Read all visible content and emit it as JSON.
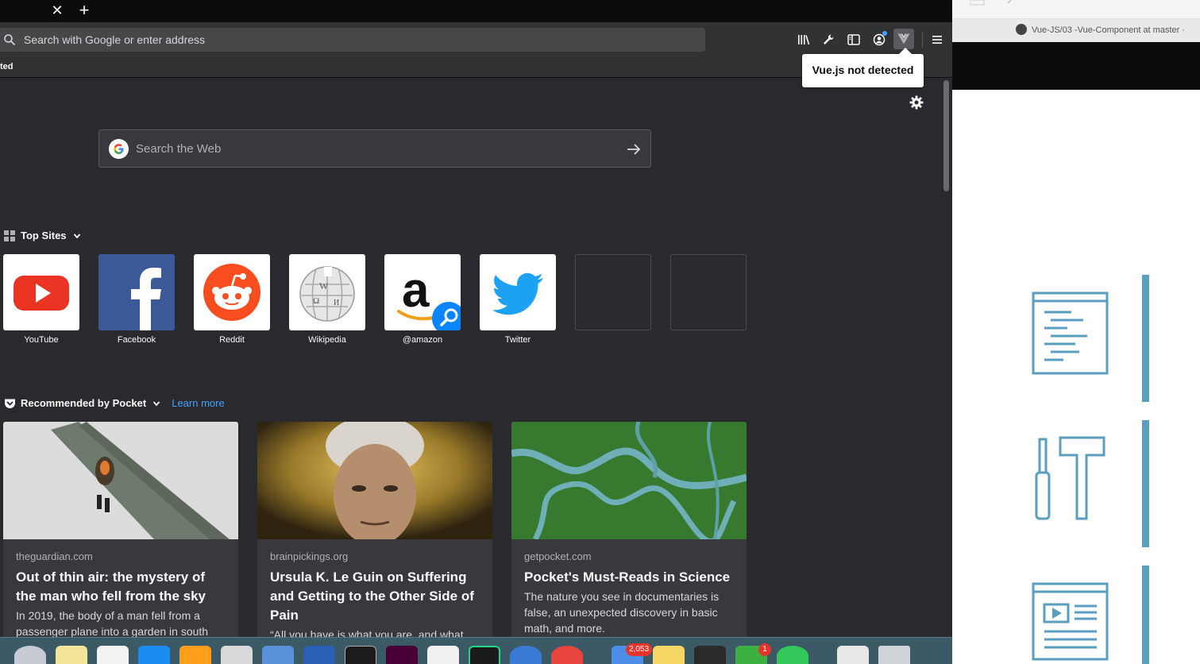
{
  "browser": {
    "toolbar": {
      "url_placeholder": "Search with Google or enter address",
      "vue_tooltip": "Vue.js not detected"
    },
    "bookmarks_fragment": "ted"
  },
  "newtab": {
    "web_search_placeholder": "Search the Web",
    "top_sites_heading": "Top Sites",
    "top_sites": [
      {
        "label": "YouTube",
        "icon": "youtube-logo"
      },
      {
        "label": "Facebook",
        "icon": "facebook-logo"
      },
      {
        "label": "Reddit",
        "icon": "reddit-logo"
      },
      {
        "label": "Wikipedia",
        "icon": "wikipedia-logo"
      },
      {
        "label": "@amazon",
        "icon": "amazon-logo"
      },
      {
        "label": "Twitter",
        "icon": "twitter-logo"
      }
    ],
    "pocket_heading": "Recommended by Pocket",
    "learn_more": "Learn more",
    "cards": [
      {
        "source": "theguardian.com",
        "title": "Out of thin air: the mystery of the man who fell from the sky",
        "description": "In 2019, the body of a man fell from a passenger plane into a garden in south"
      },
      {
        "source": "brainpickings.org",
        "title": "Ursula K. Le Guin on Suffering and Getting to the Other Side of Pain",
        "description": "“All you have is what you are, and what"
      },
      {
        "source": "getpocket.com",
        "title": "Pocket's Must-Reads in Science",
        "description": "The nature you see in documentaries is false, an unexpected discovery in basic math, and more."
      }
    ]
  },
  "other_window": {
    "tab_title": "Vue-JS/03 -Vue-Component at master ·"
  },
  "dock": {
    "mail_badge": "2,053",
    "app_badge": "1"
  }
}
